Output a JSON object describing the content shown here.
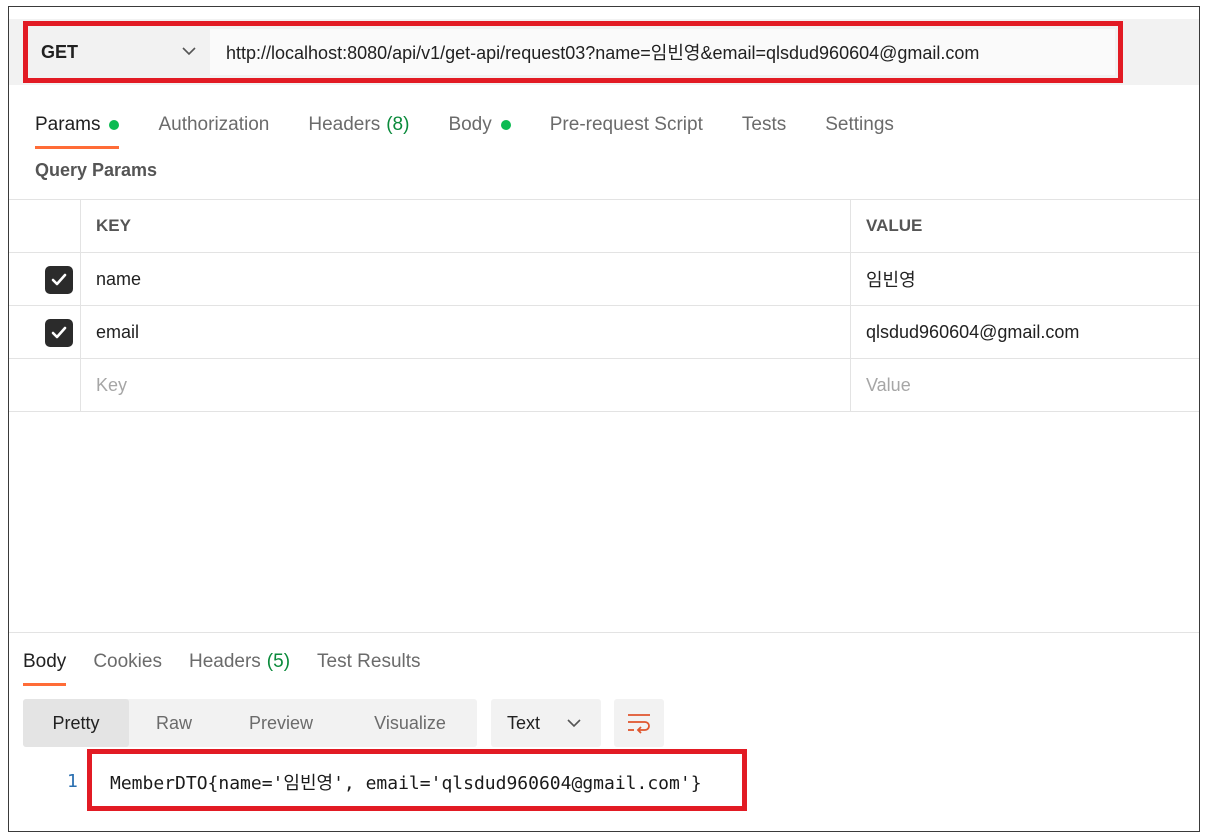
{
  "request": {
    "method": "GET",
    "url": "http://localhost:8080/api/v1/get-api/request03?name=임빈영&email=qlsdud960604@gmail.com"
  },
  "request_tabs": [
    {
      "label": "Params",
      "indicator": "dot"
    },
    {
      "label": "Authorization"
    },
    {
      "label": "Headers",
      "count": "(8)"
    },
    {
      "label": "Body",
      "indicator": "dot"
    },
    {
      "label": "Pre-request Script"
    },
    {
      "label": "Tests"
    },
    {
      "label": "Settings"
    }
  ],
  "query_params": {
    "title": "Query Params",
    "headers": {
      "key": "KEY",
      "value": "VALUE"
    },
    "rows": [
      {
        "key": "name",
        "value": "임빈영",
        "checked": true
      },
      {
        "key": "email",
        "value": "qlsdud960604@gmail.com",
        "checked": true
      }
    ],
    "placeholder": {
      "key": "Key",
      "value": "Value"
    }
  },
  "response_tabs": [
    {
      "label": "Body"
    },
    {
      "label": "Cookies"
    },
    {
      "label": "Headers",
      "count": "(5)"
    },
    {
      "label": "Test Results"
    }
  ],
  "view_modes": [
    "Pretty",
    "Raw",
    "Preview",
    "Visualize"
  ],
  "format": "Text",
  "response_body": {
    "line_number": "1",
    "text": "MemberDTO{name='임빈영', email='qlsdud960604@gmail.com'}"
  },
  "colors": {
    "highlight": "#e21b24",
    "accent": "#ff6c37",
    "dot": "#0cbb52",
    "count": "#0a8a3b"
  }
}
